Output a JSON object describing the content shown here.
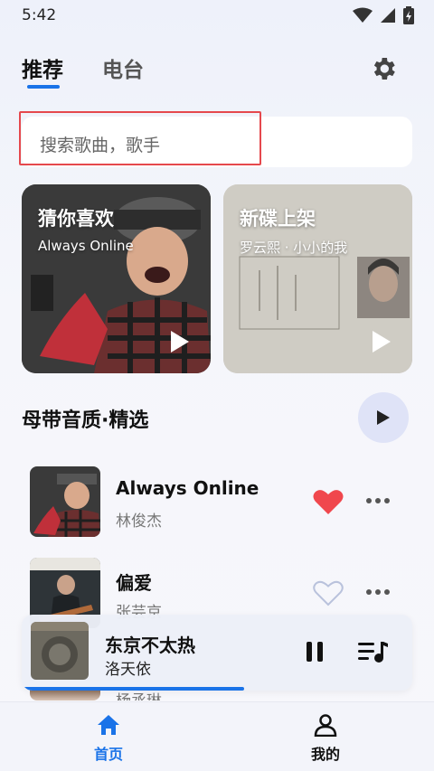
{
  "status_bar": {
    "time": "5:42"
  },
  "header": {
    "tabs": [
      {
        "label": "推荐",
        "active": true
      },
      {
        "label": "电台",
        "active": false
      }
    ],
    "settings_icon": "gear-icon"
  },
  "search": {
    "placeholder": "搜索歌曲，歌手"
  },
  "cards": [
    {
      "title": "猜你喜欢",
      "subtitle": "Always Online",
      "icon": "play-icon"
    },
    {
      "title": "新碟上架",
      "subtitle": "罗云熙 · 小小的我",
      "icon": "play-icon"
    }
  ],
  "section": {
    "title": "母带音质·精选",
    "play_icon": "play-icon"
  },
  "songs": [
    {
      "title": "Always Online",
      "artist": "林俊杰",
      "liked": true
    },
    {
      "title": "偏爱",
      "artist": "张芸京",
      "liked": false
    }
  ],
  "partial_row": {
    "artist": "杨丞琳"
  },
  "player": {
    "title": "东京不太热",
    "artist": "洛天依",
    "progress": 0.57,
    "pause_icon": "pause-icon",
    "queue_icon": "playlist-icon"
  },
  "nav": {
    "items": [
      {
        "label": "首页",
        "icon": "home-icon",
        "active": true
      },
      {
        "label": "我的",
        "icon": "person-icon",
        "active": false
      }
    ]
  },
  "colors": {
    "accent": "#1a73e8",
    "like": "#f0474d",
    "highlight_border": "#e5484d"
  }
}
